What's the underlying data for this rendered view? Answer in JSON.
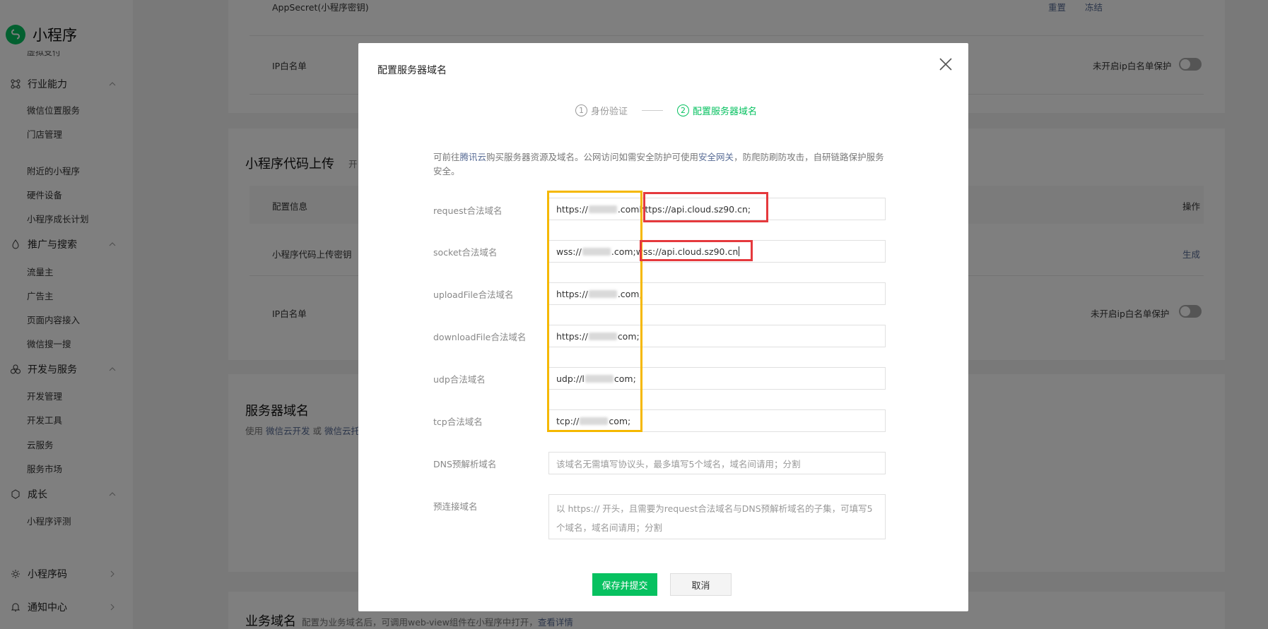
{
  "brand": {
    "name": "小程序"
  },
  "sidebar": {
    "cut_top": "虚拟支付",
    "groups": [
      {
        "label": "行业能力",
        "icon": "industry-icon",
        "items": [
          "微信位置服务",
          "门店管理",
          "附近的小程序",
          "硬件设备",
          "小程序成长计划"
        ]
      },
      {
        "label": "推广与搜索",
        "icon": "promotion-icon",
        "items": [
          "流量主",
          "广告主",
          "页面内容接入",
          "微信搜一搜"
        ]
      },
      {
        "label": "开发与服务",
        "icon": "dev-icon",
        "items": [
          "开发管理",
          "开发工具",
          "云服务",
          "服务市场"
        ]
      },
      {
        "label": "成长",
        "icon": "growth-icon",
        "items": [
          "小程序评测"
        ]
      }
    ],
    "bottom": [
      {
        "label": "小程序码",
        "icon": "qrcode-icon"
      },
      {
        "label": "通知中心",
        "icon": "bell-icon"
      }
    ]
  },
  "background": {
    "appsecret_label": "AppSecret(小程序密钥)",
    "reset": "重置",
    "freeze": "冻结",
    "ip_whitelist": "IP白名单",
    "ip_protect": "未开启ip白名单保护",
    "upload_section_title": "小程序代码上传",
    "upload_section_sub": "开",
    "config_info": "配置信息",
    "operation": "操作",
    "upload_key": "小程序代码上传密钥",
    "generate": "生成",
    "server_domain_title": "服务器域名",
    "server_domain_sub_prefix": "使用",
    "server_domain_link1": "微信云开发",
    "server_domain_or": "或",
    "server_domain_link2": "微信云托",
    "biz_domain_title": "业务域名",
    "biz_domain_sub": "配置为业务域名后，可调用web-view组件在小程序中打开，",
    "biz_domain_link": "查看详情"
  },
  "dialog": {
    "title": "配置服务器域名",
    "steps": [
      {
        "num": "1",
        "label": "身份验证"
      },
      {
        "num": "2",
        "label": "配置服务器域名"
      }
    ],
    "notice": {
      "p1": "可前往",
      "link1": "腾讯云",
      "p2": "购买服务器资源及域名。公网访问如需安全防护可使用",
      "link2": "安全网关",
      "p3": "，防爬防刷防攻击，自研链路保护服务安全。"
    },
    "fields": [
      {
        "label": "request合法域名",
        "prefix": "https://",
        "suffix": ".com",
        "added": "https://api.cloud.sz90.cn;"
      },
      {
        "label": "socket合法域名",
        "prefix": "wss://",
        "suffix": ".com;",
        "added": "wss://api.cloud.sz90.cn"
      },
      {
        "label": "uploadFile合法域名",
        "prefix": "https://",
        "suffix": ".com;",
        "added": ""
      },
      {
        "label": "downloadFile合法域名",
        "prefix": "https://",
        "suffix": "com;",
        "added": ""
      },
      {
        "label": "udp合法域名",
        "prefix": "udp://l",
        "suffix": "com;",
        "added": ""
      },
      {
        "label": "tcp合法域名",
        "prefix": "tcp://",
        "suffix": "com;",
        "added": ""
      }
    ],
    "dns_label": "DNS预解析域名",
    "dns_placeholder": "该域名无需填写协议头，最多填写5个域名，域名间请用；分割",
    "preconnect_label": "预连接域名",
    "preconnect_placeholder": "以 https:// 开头，且需要为request合法域名与DNS预解析域名的子集，可填写5个域名，域名间请用；分割",
    "save_button": "保存并提交",
    "cancel_button": "取消"
  },
  "colors": {
    "accent": "#07c160",
    "link": "#576b95",
    "highlight_yellow": "#f5b800",
    "highlight_red": "#e5393d"
  }
}
